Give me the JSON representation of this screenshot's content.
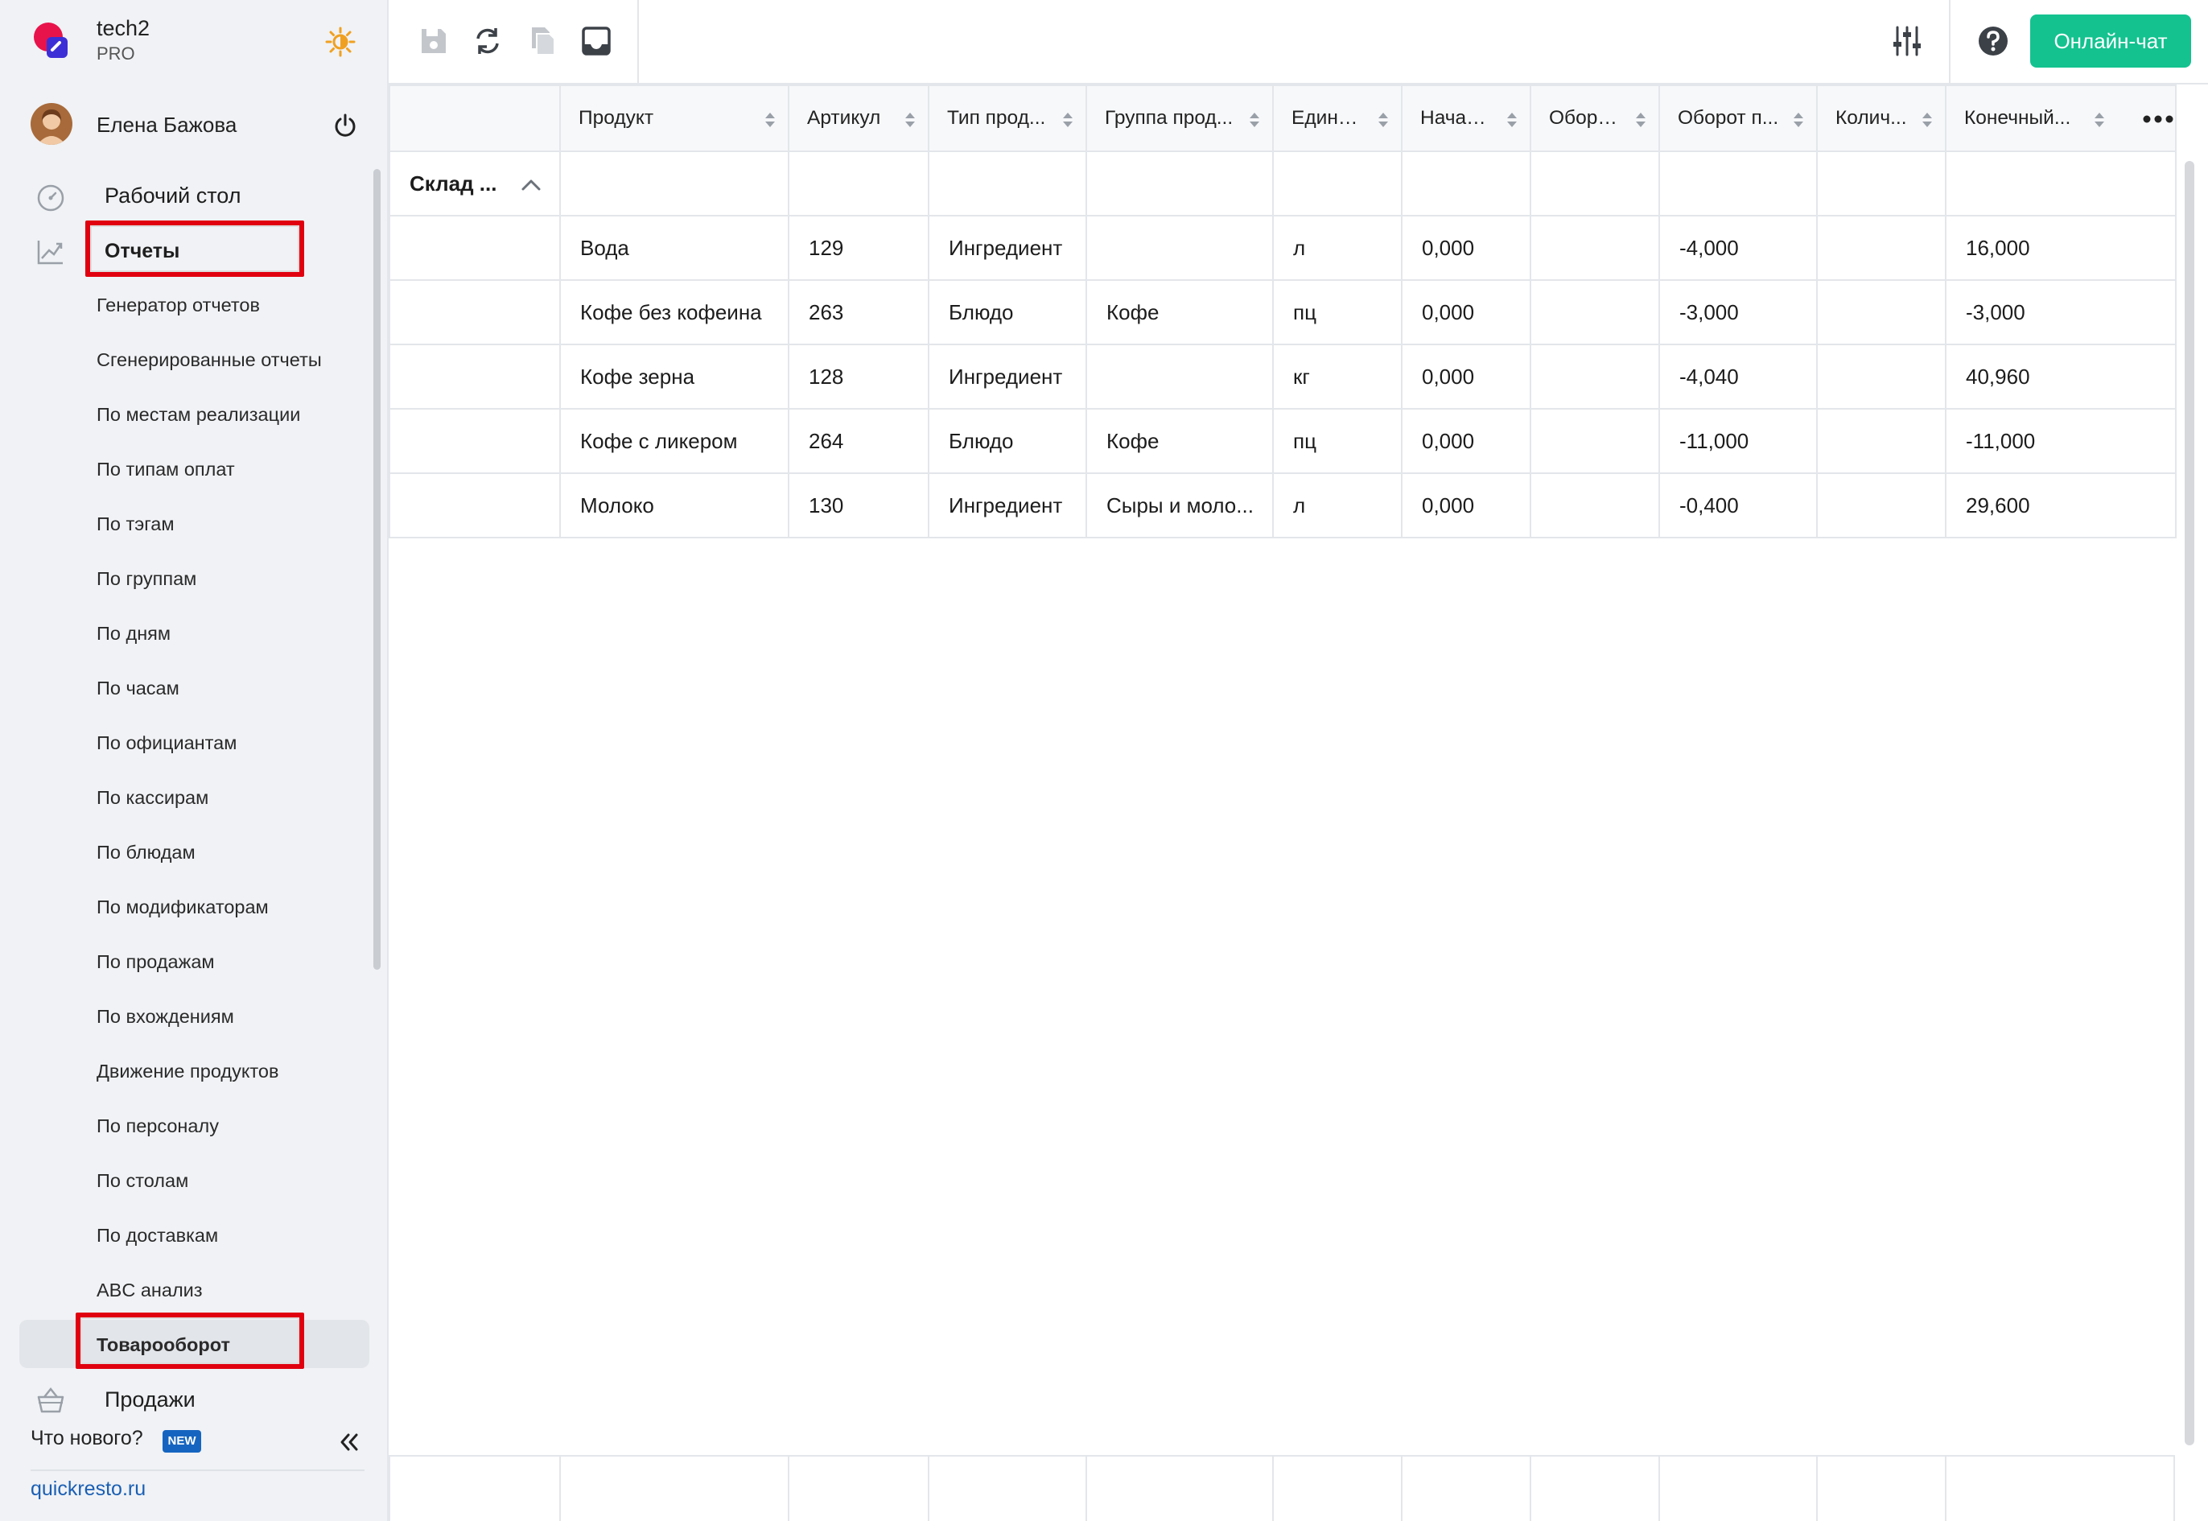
{
  "brand": {
    "name": "tech2",
    "plan": "PRO",
    "logo_icon": "app-logo",
    "theme_icon": "sun-icon"
  },
  "user": {
    "name": "Елена Бажова",
    "avatar_icon": "user-avatar",
    "logout_icon": "power-icon"
  },
  "nav": {
    "desktop": {
      "label": "Рабочий стол",
      "icon": "speedometer-icon"
    },
    "reports": {
      "label": "Отчеты",
      "icon": "chart-trend-icon"
    },
    "report_items": [
      "Генератор отчетов",
      "Сгенерированные отчеты",
      "По местам реализации",
      "По типам оплат",
      "По тэгам",
      "По группам",
      "По дням",
      "По часам",
      "По официантам",
      "По кассирам",
      "По блюдам",
      "По модификаторам",
      "По продажам",
      "По вхождениям",
      "Движение продуктов",
      "По персоналу",
      "По столам",
      "По доставкам",
      "ABC анализ",
      "Товарооборот"
    ],
    "active_item": "Товарооборот",
    "sales": {
      "label": "Продажи",
      "icon": "basket-icon"
    }
  },
  "footer": {
    "whats_new": "Что нового?",
    "new_badge": "NEW",
    "site": "quickresto.ru"
  },
  "toolbar": {
    "chat_label": "Онлайн-чат"
  },
  "colors": {
    "accent": "#13c28f",
    "highlight": "#e0000f",
    "link": "#1a5fb4"
  },
  "table": {
    "columns": [
      "",
      "Продукт",
      "Артикул",
      "Тип прод...",
      "Группа прод...",
      "Едини...",
      "Начал...",
      "Оборо...",
      "Оборот п...",
      "Колич...",
      "Конечный..."
    ],
    "group_label": "Склад ...",
    "rows": [
      [
        "",
        "Вода",
        "129",
        "Ингредиент",
        "",
        "л",
        "0,000",
        "",
        "-4,000",
        "",
        "16,000"
      ],
      [
        "",
        "Кофе без кофеина",
        "263",
        "Блюдо",
        "Кофе",
        "пц",
        "0,000",
        "",
        "-3,000",
        "",
        "-3,000"
      ],
      [
        "",
        "Кофе зерна",
        "128",
        "Ингредиент",
        "",
        "кг",
        "0,000",
        "",
        "-4,040",
        "",
        "40,960"
      ],
      [
        "",
        "Кофе с ликером",
        "264",
        "Блюдо",
        "Кофе",
        "пц",
        "0,000",
        "",
        "-11,000",
        "",
        "-11,000"
      ],
      [
        "",
        "Молоко",
        "130",
        "Ингредиент",
        "Сыры и моло...",
        "л",
        "0,000",
        "",
        "-0,400",
        "",
        "29,600"
      ]
    ]
  }
}
